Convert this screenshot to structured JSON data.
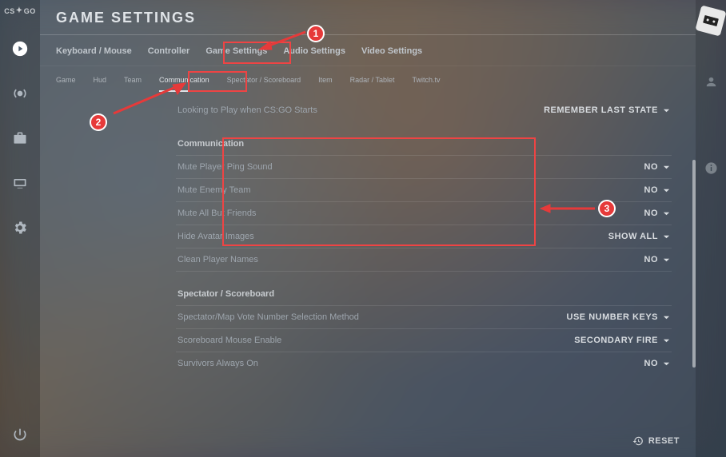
{
  "logo": "CS:GO",
  "page_title": "GAME SETTINGS",
  "primary_tabs": {
    "keyboard": "Keyboard / Mouse",
    "controller": "Controller",
    "game": "Game Settings",
    "audio": "Audio Settings",
    "video": "Video Settings"
  },
  "secondary_tabs": {
    "game": "Game",
    "hud": "Hud",
    "team": "Team",
    "communication": "Communication",
    "spectator": "Spectator / Scoreboard",
    "item": "Item",
    "radar": "Radar / Tablet",
    "twitch": "Twitch.tv"
  },
  "top_row": {
    "label": "Looking to Play when CS:GO Starts",
    "value": "REMEMBER LAST STATE"
  },
  "section_comm": "Communication",
  "comm_rows": {
    "ping": {
      "label": "Mute Player Ping Sound",
      "value": "NO"
    },
    "enemy": {
      "label": "Mute Enemy Team",
      "value": "NO"
    },
    "friends": {
      "label": "Mute All But Friends",
      "value": "NO"
    },
    "avatar": {
      "label": "Hide Avatar Images",
      "value": "SHOW ALL"
    },
    "clean": {
      "label": "Clean Player Names",
      "value": "NO"
    }
  },
  "section_spec": "Spectator / Scoreboard",
  "spec_rows": {
    "vote": {
      "label": "Spectator/Map Vote Number Selection Method",
      "value": "USE NUMBER KEYS"
    },
    "mouse": {
      "label": "Scoreboard Mouse Enable",
      "value": "SECONDARY FIRE"
    },
    "survivors": {
      "label": "Survivors Always On",
      "value": "NO"
    }
  },
  "reset": "RESET",
  "annotations": {
    "n1": "1",
    "n2": "2",
    "n3": "3"
  }
}
